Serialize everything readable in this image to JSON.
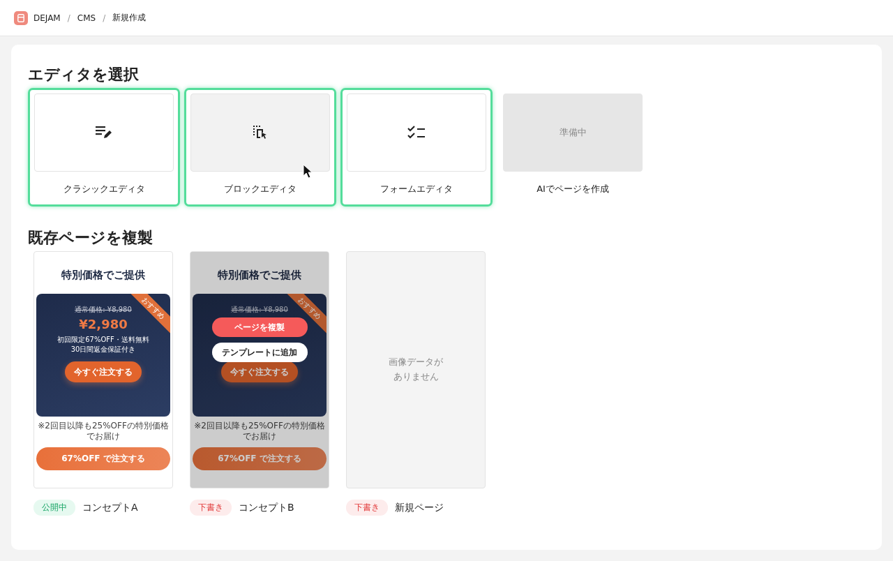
{
  "breadcrumb": {
    "separator": "/",
    "items": [
      "DEJAM",
      "CMS",
      "新規作成"
    ]
  },
  "editor_section": {
    "title": "エディタを選択",
    "editors": [
      {
        "label": "クラシックエディタ",
        "kind": "classic",
        "selected": true,
        "hovered": false
      },
      {
        "label": "ブロックエディタ",
        "kind": "block",
        "selected": true,
        "hovered": true
      },
      {
        "label": "フォームエディタ",
        "kind": "form",
        "selected": true,
        "hovered": false
      },
      {
        "label": "AIでページを作成",
        "kind": "pending",
        "selected": false,
        "hovered": false,
        "badge": "準備中"
      }
    ]
  },
  "pages_section": {
    "title": "既存ページを複製",
    "pages": [
      {
        "name": "コンセプトA",
        "status": {
          "label": "公開中",
          "kind": "published"
        },
        "hovered": false,
        "preview": {
          "title": "特別価格でご提供",
          "ribbon": "おすすめ",
          "old_price": "通常価格: ¥8,980",
          "price": "¥2,980",
          "features": [
            "初回限定67%OFF・送料無料",
            "30日間返金保証付き"
          ],
          "cta": "今すぐ注文する",
          "note": "※2回目以降も25%OFFの特別価格でお届け",
          "bottom_cta": "67%OFF で注文する"
        }
      },
      {
        "name": "コンセプトB",
        "status": {
          "label": "下書き",
          "kind": "draft"
        },
        "hovered": true,
        "actions": [
          {
            "label": "ページを複製",
            "kind": "primary"
          },
          {
            "label": "テンプレートに追加",
            "kind": "secondary"
          }
        ],
        "preview": {
          "title": "特別価格でご提供",
          "ribbon": "おすすめ",
          "old_price": "通常価格: ¥8,980",
          "cta": "今すぐ注文する",
          "note": "※2回目以降も25%OFFの特別価格でお届け",
          "bottom_cta": "67%OFF で注文する"
        }
      },
      {
        "name": "新規ページ",
        "status": {
          "label": "下書き",
          "kind": "draft"
        },
        "hovered": false,
        "empty_text": [
          "画像データが",
          "ありません"
        ]
      }
    ]
  }
}
